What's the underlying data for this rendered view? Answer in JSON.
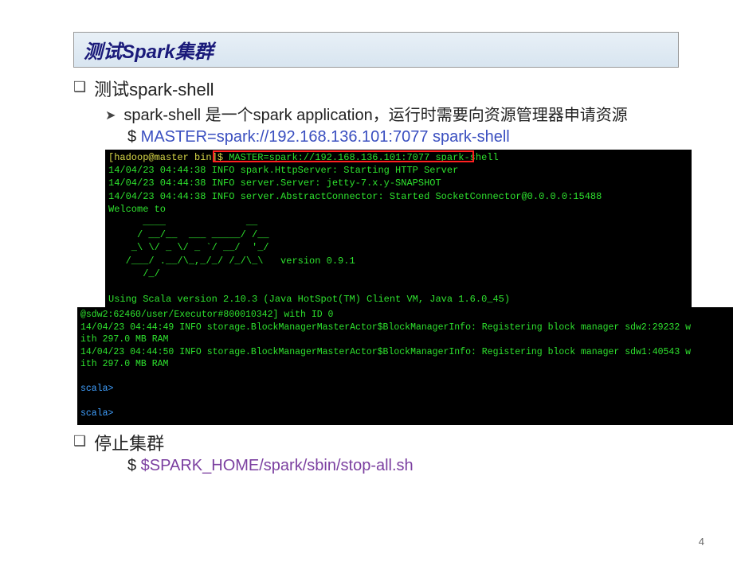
{
  "title": "测试Spark集群",
  "bullets": {
    "b1": "测试spark-shell",
    "b2": "spark-shell 是一个spark application，运行时需要向资源管理器申请资源",
    "b3": "停止集群"
  },
  "commands": {
    "c1_dollar": "$",
    "c1_text": " MASTER=spark://192.168.136.101:7077 spark-shell",
    "c2_dollar": "$",
    "c2_text": " $SPARK_HOME/spark/sbin/stop-all.sh"
  },
  "terminal1": {
    "prompt": "[hadoop@master bin]$ ",
    "cmd": "MASTER=spark://192.168.136.101:7077 spark-shell",
    "line1": "14/04/23 04:44:38 INFO spark.HttpServer: Starting HTTP Server",
    "line2": "14/04/23 04:44:38 INFO server.Server: jetty-7.x.y-SNAPSHOT",
    "line3": "14/04/23 04:44:38 INFO server.AbstractConnector: Started SocketConnector@0.0.0.0:15488",
    "line4": "Welcome to",
    "ascii1": "      ____              __",
    "ascii2": "     / __/__  ___ _____/ /__",
    "ascii3": "    _\\ \\/ _ \\/ _ `/ __/  '_/",
    "ascii4": "   /___/ .__/\\_,_/_/ /_/\\_\\   version 0.9.1",
    "ascii5": "      /_/",
    "line5": "",
    "line6": "Using Scala version 2.10.3 (Java HotSpot(TM) Client VM, Java 1.6.0_45)"
  },
  "terminal2": {
    "l1": "@sdw2:62460/user/Executor#800010342] with ID 0",
    "l2": "14/04/23 04:44:49 INFO storage.BlockManagerMasterActor$BlockManagerInfo: Registering block manager sdw2:29232 w",
    "l3": "ith 297.0 MB RAM",
    "l4": "14/04/23 04:44:50 INFO storage.BlockManagerMasterActor$BlockManagerInfo: Registering block manager sdw1:40543 w",
    "l5": "ith 297.0 MB RAM",
    "blank": "",
    "prompt1": "scala>",
    "prompt2": "scala>"
  },
  "page_number": "4"
}
